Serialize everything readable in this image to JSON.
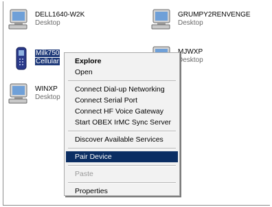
{
  "devices": [
    {
      "name": "DELL1640-W2K",
      "type": "Desktop"
    },
    {
      "name": "GRUMPY2RENVENGE",
      "type": "Desktop"
    },
    {
      "name": "Milk750",
      "type": "Cellular"
    },
    {
      "name": "MJWXP",
      "type": "Desktop"
    },
    {
      "name": "WINXP",
      "type": "Desktop"
    }
  ],
  "menu": {
    "items": [
      "Explore",
      "Open",
      "Connect Dial-up Networking",
      "Connect Serial Port",
      "Connect HF Voice Gateway",
      "Start OBEX IrMC Sync Server",
      "Discover Available Services",
      "Pair Device",
      "Paste",
      "Properties"
    ],
    "default_item": "Explore",
    "highlighted_item": "Pair Device",
    "disabled_items": [
      "Paste"
    ]
  },
  "icons": {
    "desktop": "desktop-computer-icon",
    "cellular": "cell-phone-icon"
  },
  "colors": {
    "selection": "#0b2e63",
    "menu_bg": "#f2f2f2"
  }
}
